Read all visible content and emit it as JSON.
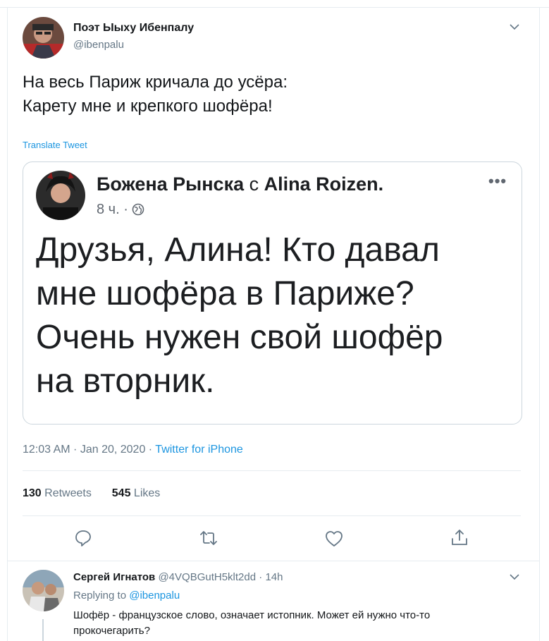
{
  "tweet": {
    "author_name": "Поэт Ыыху Ибенпалу",
    "author_handle": "@ibenpalu",
    "text_lines": [
      "На весь Париж кричала до усёра:",
      "Карету мне и крепкого шофёра!"
    ],
    "translate_label": "Translate Tweet",
    "time": "12:03 AM",
    "date": "Jan 20, 2020",
    "source": "Twitter for iPhone",
    "retweets_count": "130",
    "retweets_label": "Retweets",
    "likes_count": "545",
    "likes_label": "Likes",
    "icons": {
      "more": "chevron-down-icon",
      "reply": "reply-icon",
      "retweet": "retweet-icon",
      "like": "heart-icon",
      "share": "share-icon"
    }
  },
  "embedded_post": {
    "author": "Божена Рынска",
    "with_word": "с",
    "tagged": "Alina Roizen.",
    "time": "8 ч.",
    "separator": "·",
    "more_label": "•••",
    "text_lines": [
      "Друзья, Алина! Кто давал",
      "мне шофёра в Париже?",
      "Очень нужен свой шофёр",
      "на вторник."
    ],
    "icons": {
      "privacy": "globe-icon"
    }
  },
  "reply": {
    "author_name": "Сергей Игнатов",
    "author_handle": "@4VQBGutH5klt2dd",
    "separator": "·",
    "time": "14h",
    "replying_label": "Replying to",
    "replying_to": "@ibenpalu",
    "text_lines": [
      "Шофёр - французское слово, означает истопник. Может ей нужно что-то",
      "прокочегарить?"
    ]
  },
  "colors": {
    "link": "#1b95e0",
    "muted": "#657786",
    "border": "#e6ecf0"
  }
}
